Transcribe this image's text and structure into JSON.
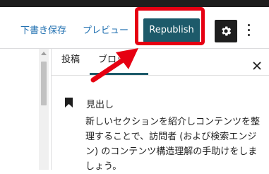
{
  "toolbar": {
    "save_draft": "下書き保存",
    "preview": "プレビュー",
    "republish": "Republish",
    "settings_icon": "gear-icon",
    "more_icon": "vertical-ellipsis-icon"
  },
  "sidebar": {
    "tabs": [
      {
        "label": "投稿"
      },
      {
        "label": "ブロック",
        "active": true
      }
    ],
    "close_icon": "close-icon",
    "block": {
      "icon": "bookmark-icon",
      "title": "見出し",
      "description": "新しいセクションを紹介しコンテンツを整理することで、訪問者 (および検索エンジン) のコンテンツ構造理解の手助けをしましょう。"
    }
  },
  "annotation": {
    "highlight_color": "#e60012"
  },
  "colors": {
    "accent": "#1d5a6a",
    "link": "#2271b1"
  }
}
